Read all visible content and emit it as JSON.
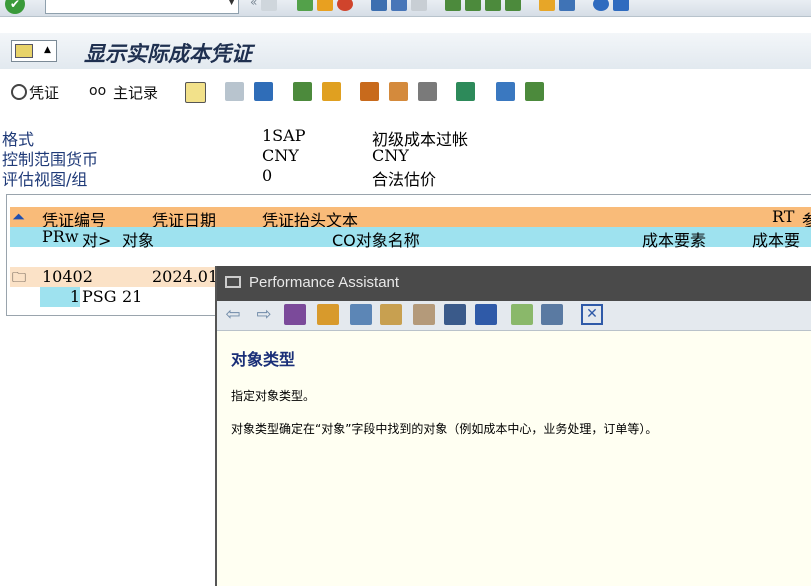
{
  "title": "显示实际成本凭证",
  "toolbar": {
    "voucher_label": "凭证",
    "master_label": "主记录"
  },
  "header": {
    "rows": [
      {
        "label": "格式",
        "code": "1SAP",
        "desc": "初级成本过帐"
      },
      {
        "label": "控制范围货币",
        "code": "CNY",
        "desc": "CNY"
      },
      {
        "label": "评估视图/组",
        "code": "0",
        "desc": "合法估价"
      }
    ]
  },
  "list": {
    "header1": {
      "doc_no": "凭证编号",
      "doc_date": "凭证日期",
      "doc_text": "凭证抬头文本",
      "rt": "RT",
      "ref": "参"
    },
    "header2": {
      "prw": "PRw",
      "obj_type": "对>",
      "obj": "对象",
      "obj_name": "CO对象名称",
      "cost_elem": "成本要素",
      "cost_elem_name": "成本要"
    },
    "row1": {
      "doc_no": "10402",
      "doc_date": "2024.01"
    },
    "row2": {
      "prw": "1",
      "obj_type": "PSG",
      "obj": "21"
    }
  },
  "assistant": {
    "title": "Performance Assistant",
    "heading": "对象类型",
    "p1": "指定对象类型。",
    "p2": "对象类型确定在“对象”字段中找到的对象（例如成本中心，业务处理，订单等）。"
  }
}
